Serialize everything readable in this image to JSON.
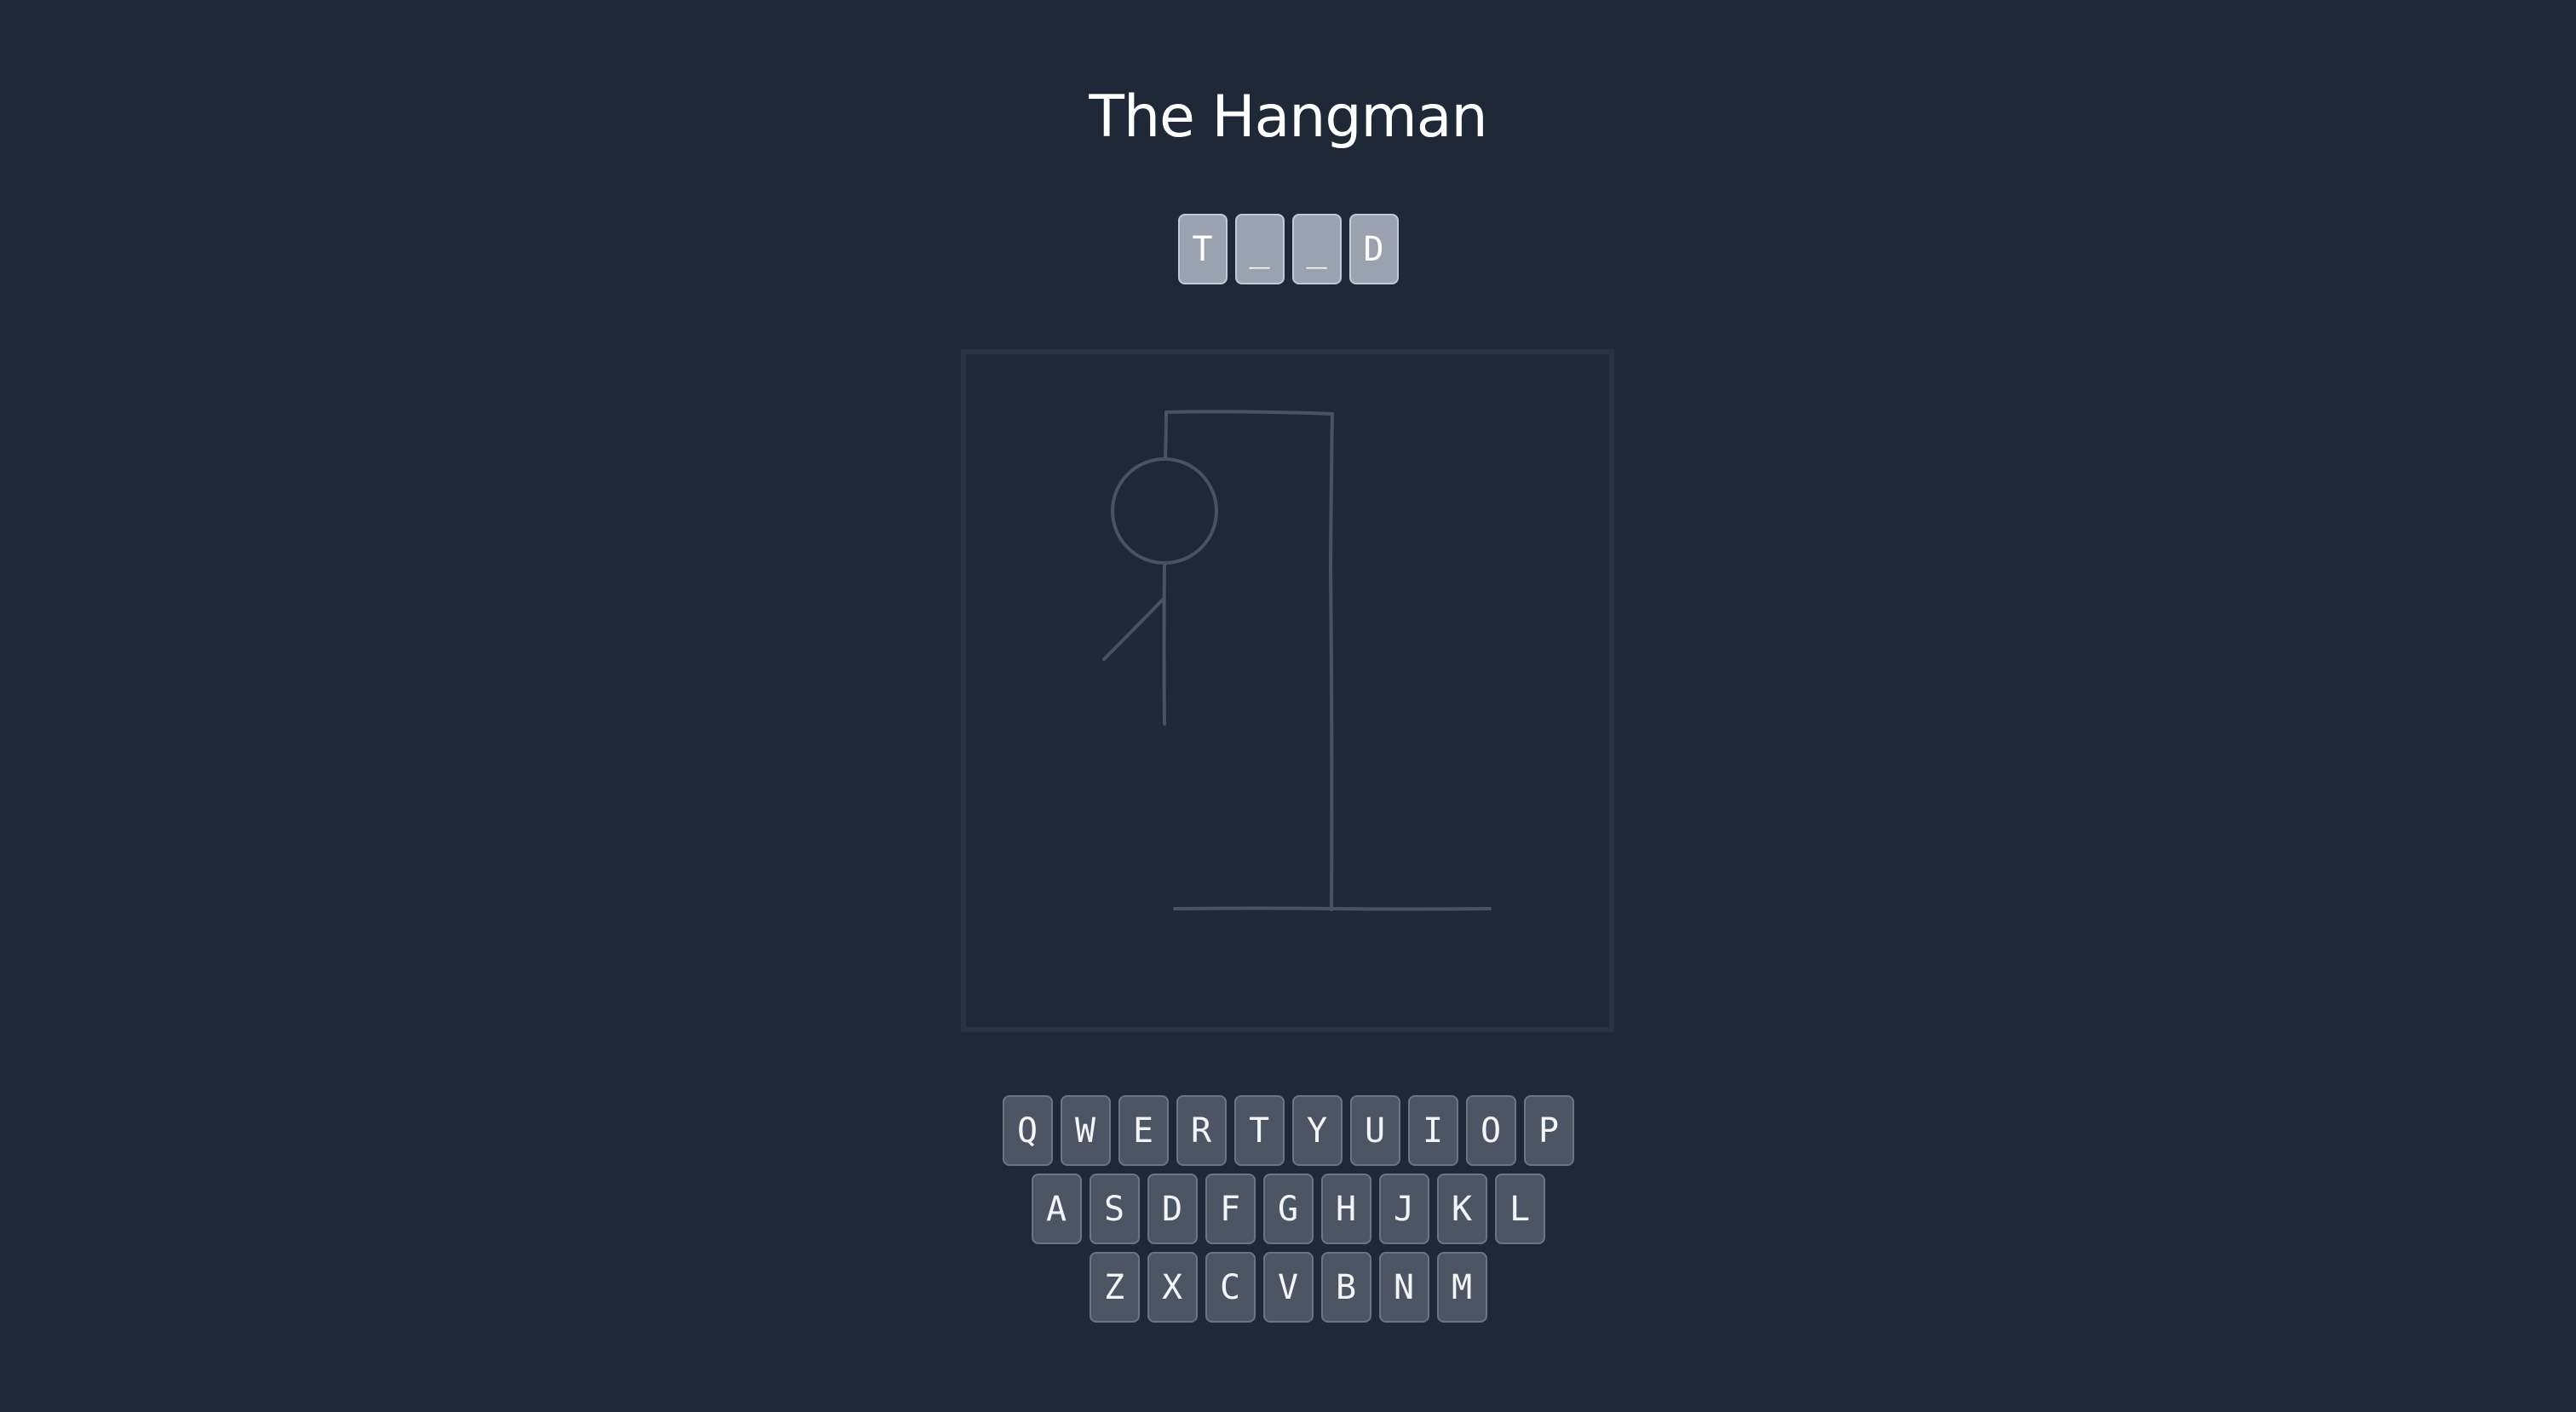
{
  "title": "The Hangman",
  "word_slots": [
    "T",
    "_",
    "_",
    "D"
  ],
  "keyboard": {
    "rows": [
      [
        "Q",
        "W",
        "E",
        "R",
        "T",
        "Y",
        "U",
        "I",
        "O",
        "P"
      ],
      [
        "A",
        "S",
        "D",
        "F",
        "G",
        "H",
        "J",
        "K",
        "L"
      ],
      [
        "Z",
        "X",
        "C",
        "V",
        "B",
        "N",
        "M"
      ]
    ]
  },
  "hangman_parts_shown": [
    "gallows-base",
    "gallows-pole",
    "gallows-beam",
    "rope",
    "head",
    "body",
    "left-arm"
  ],
  "colors": {
    "background": "#1e2837",
    "key_fill": "#4b5563",
    "slot_fill": "#9aa2af",
    "drawing_stroke": "#4a5260"
  }
}
